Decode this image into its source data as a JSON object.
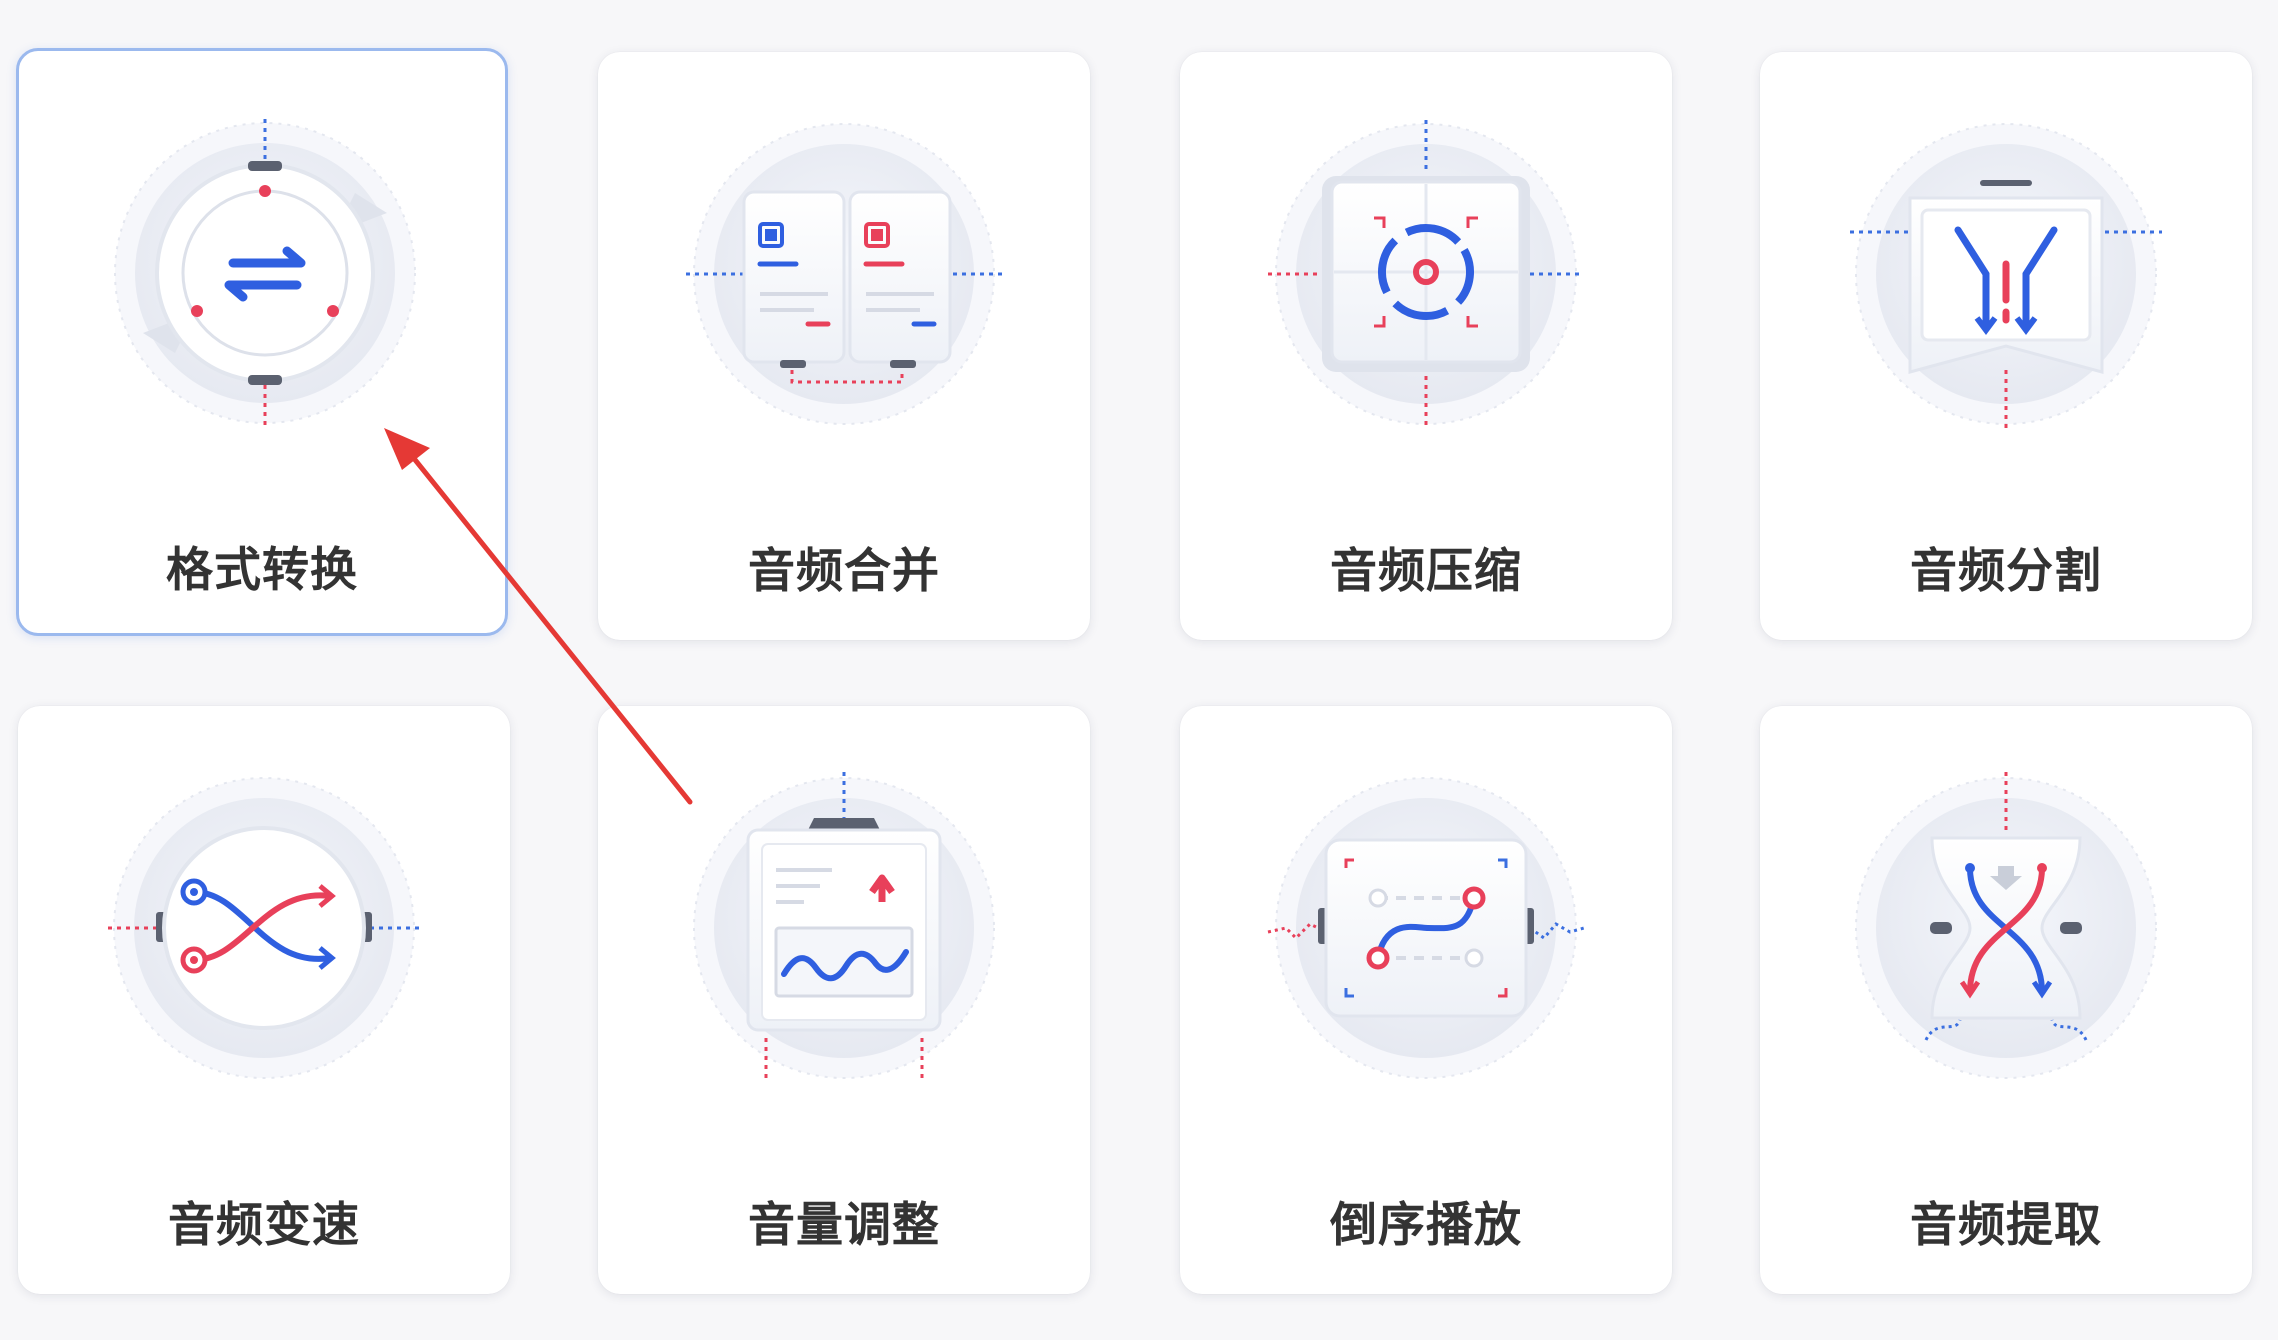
{
  "colors": {
    "card_bg": "#ffffff",
    "page_bg": "#f7f7f9",
    "accent_blue": "#2f5fe0",
    "accent_red": "#e8405a",
    "selected_border": "#9bb9ee",
    "annotation_arrow": "#e53935"
  },
  "tools": [
    {
      "label": "格式转换",
      "icon": "format-convert-icon",
      "selected": true
    },
    {
      "label": "音频合并",
      "icon": "audio-merge-icon",
      "selected": false
    },
    {
      "label": "音频压缩",
      "icon": "audio-compress-icon",
      "selected": false
    },
    {
      "label": "音频分割",
      "icon": "audio-split-icon",
      "selected": false
    },
    {
      "label": "音频变速",
      "icon": "audio-speed-icon",
      "selected": false
    },
    {
      "label": "音量调整",
      "icon": "volume-adjust-icon",
      "selected": false
    },
    {
      "label": "倒序播放",
      "icon": "reverse-play-icon",
      "selected": false
    },
    {
      "label": "音频提取",
      "icon": "audio-extract-icon",
      "selected": false
    }
  ]
}
